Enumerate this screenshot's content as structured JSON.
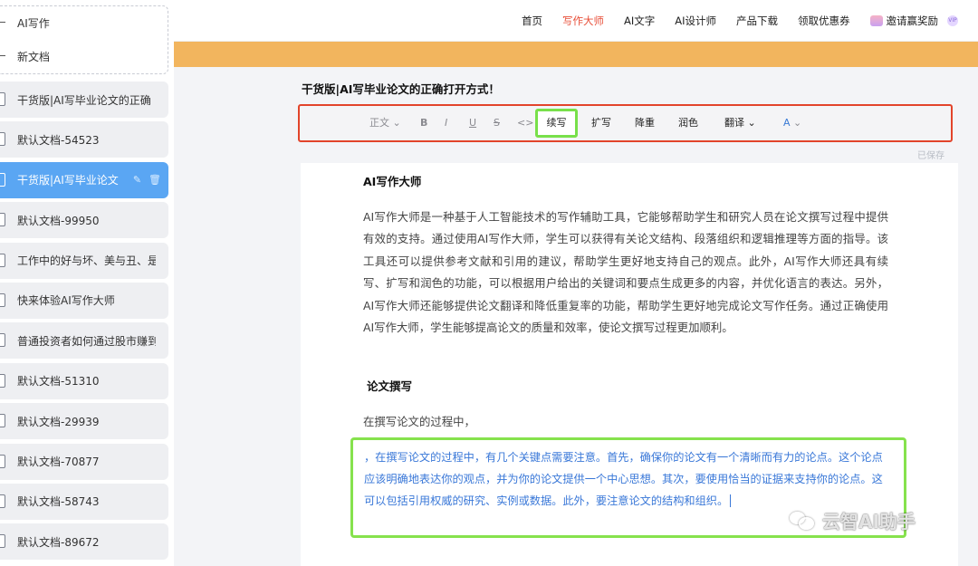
{
  "sidebar": {
    "top_menu": [
      {
        "label": "AI写作"
      },
      {
        "label": "新文档"
      }
    ],
    "documents": [
      {
        "label": "干货版|AI写毕业论文的正确"
      },
      {
        "label": "默认文档-54523"
      },
      {
        "label": "干货版|AI写毕业论文",
        "active": true
      },
      {
        "label": "默认文档-99950"
      },
      {
        "label": "工作中的好与坏、美与丑、是"
      },
      {
        "label": "快来体验AI写作大师"
      },
      {
        "label": "普通投资者如何通过股市赚到"
      },
      {
        "label": "默认文档-51310"
      },
      {
        "label": "默认文档-29939"
      },
      {
        "label": "默认文档-70877"
      },
      {
        "label": "默认文档-58743"
      },
      {
        "label": "默认文档-89672"
      }
    ]
  },
  "nav": {
    "items": [
      "首页",
      "写作大师",
      "AI文字",
      "AI设计师",
      "产品下载",
      "领取优惠券",
      "邀请赢奖励"
    ],
    "active": "写作大师",
    "active_color": "#e8503a",
    "vip_label": "VIP"
  },
  "editor": {
    "title": "干货版|AI写毕业论文的正确打开方式！",
    "toolbar": {
      "style_select": "正文",
      "bold": "B",
      "italic": "I",
      "underline": "U",
      "strike": "S",
      "code": "<>",
      "continue": "续写",
      "expand": "扩写",
      "dedupe": "降重",
      "polish": "润色",
      "translate": "翻译",
      "font_color": "A"
    },
    "saved_status": "已保存",
    "heading1": "AI写作大师",
    "paragraph1": "AI写作大师是一种基于人工智能技术的写作辅助工具，它能够帮助学生和研究人员在论文撰写过程中提供有效的支持。通过使用AI写作大师，学生可以获得有关论文结构、段落组织和逻辑推理等方面的指导。该工具还可以提供参考文献和引用的建议，帮助学生更好地支持自己的观点。此外，AI写作大师还具有续写、扩写和润色的功能，可以根据用户给出的关键词和要点生成更多的内容，并优化语言的表达。另外，AI写作大师还能够提供论文翻译和降低重复率的功能，帮助学生更好地完成论文写作任务。通过正确使用AI写作大师，学生能够提高论文的质量和效率，使论文撰写过程更加顺利。",
    "heading2": "论文撰写",
    "lead": "在撰写论文的过程中，",
    "generated": "，在撰写论文的过程中，有几个关键点需要注意。首先，确保你的论文有一个清晰而有力的论点。这个论点应该明确地表达你的观点，并为你的论文提供一个中心思想。其次，要使用恰当的证据来支持你的论点。这可以包括引用权威的研究、实例或数据。此外，要注意论文的结构和组织。"
  },
  "watermark": "云智AI助手",
  "colors": {
    "toolbar_highlight": "#e2442b",
    "continue_highlight": "#78e04a",
    "generated_text": "#3a78d8",
    "active_doc": "#5aa6f3",
    "banner": "#f2b55e"
  }
}
